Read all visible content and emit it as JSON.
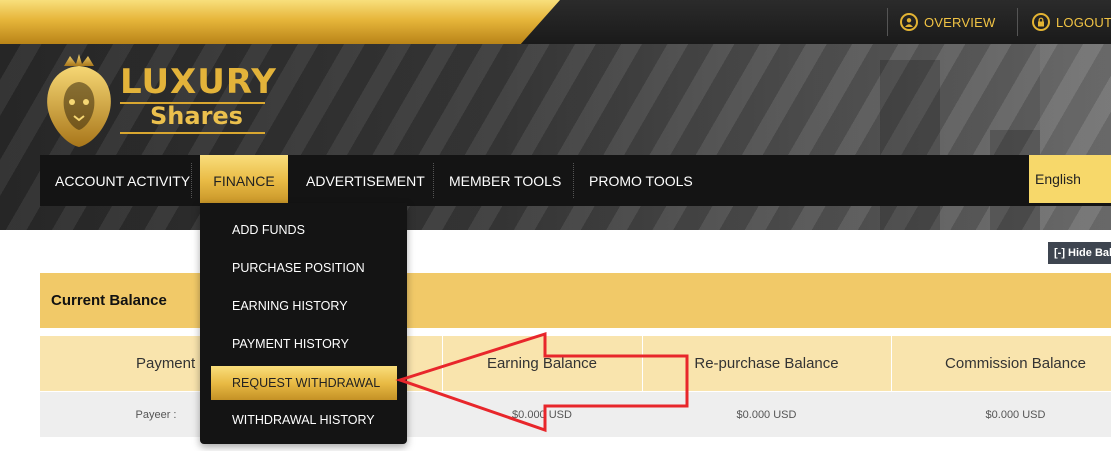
{
  "topbar": {
    "overview_label": "OVERVIEW",
    "overview_icon": "user-circle-icon",
    "logout_label": "LOGOUT",
    "logout_icon": "lock-circle-icon",
    "accent": "#f2c444"
  },
  "logo": {
    "word1": "LUXURY",
    "word2": "Shares",
    "icon": "lion-crest-icon"
  },
  "nav": {
    "items": [
      {
        "label": "ACCOUNT ACTIVITY"
      },
      {
        "label": "FINANCE",
        "active": true
      },
      {
        "label": "ADVERTISEMENT"
      },
      {
        "label": "MEMBER TOOLS"
      },
      {
        "label": "PROMO TOOLS"
      }
    ],
    "language": "English"
  },
  "finance_menu": {
    "items": [
      {
        "label": "ADD FUNDS"
      },
      {
        "label": "PURCHASE POSITION"
      },
      {
        "label": "EARNING HISTORY"
      },
      {
        "label": "PAYMENT HISTORY"
      },
      {
        "label": "REQUEST WITHDRAWAL",
        "active": true
      },
      {
        "label": "WITHDRAWAL HISTORY"
      }
    ]
  },
  "balance": {
    "hide_label": "[-] Hide Bal",
    "title": "Current Balance",
    "columns": [
      "Payment Proces",
      "Earning Balance",
      "Re-purchase Balance",
      "Commission Balance"
    ],
    "row": [
      "Payeer :",
      "$0.000 USD",
      "$0.000 USD",
      "$0.000 USD"
    ]
  },
  "colors": {
    "gold": "#e9bb45",
    "header_bg": "#f1c968",
    "columns_bg": "#f9e4ad",
    "arrow": "#e8262b"
  }
}
